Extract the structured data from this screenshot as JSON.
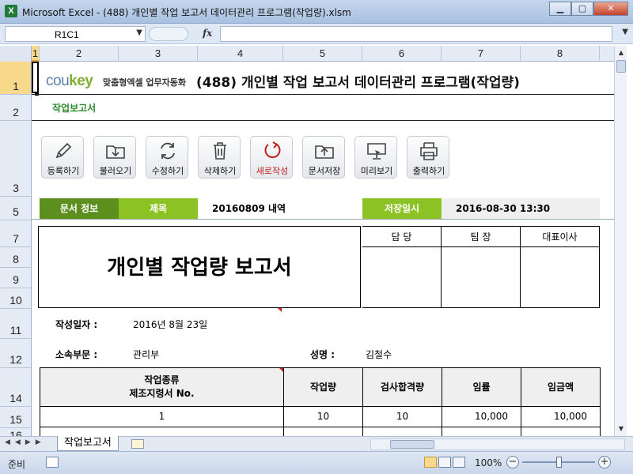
{
  "window": {
    "title": "Microsoft Excel - (488) 개인별 작업 보고서 데이터관리 프로그램(작업량).xlsm",
    "app_icon": "X"
  },
  "formula_bar": {
    "name_box": "R1C1",
    "fx_label": "fx",
    "formula": ""
  },
  "columns": [
    "1",
    "2",
    "3",
    "4",
    "5",
    "6",
    "7",
    "8"
  ],
  "rows": [
    "1",
    "2",
    "3",
    "5",
    "7",
    "8",
    "9",
    "10",
    "11",
    "12",
    "14",
    "15",
    "16"
  ],
  "header": {
    "logo_main": "cou",
    "logo_accent": "key",
    "logo_sub": "맞춤형엑셀 업무자동화",
    "title": "(488) 개인별 작업 보고서 데이터관리 프로그램(작업량)",
    "subtitle": "작업보고서"
  },
  "toolbar": [
    {
      "label": "등록하기",
      "icon": "pencil-icon"
    },
    {
      "label": "불러오기",
      "icon": "download-folder-icon"
    },
    {
      "label": "수정하기",
      "icon": "refresh-icon"
    },
    {
      "label": "삭제하기",
      "icon": "trash-icon"
    },
    {
      "label": "새로작성",
      "icon": "new-document-icon"
    },
    {
      "label": "문서저장",
      "icon": "upload-folder-icon"
    },
    {
      "label": "미리보기",
      "icon": "monitor-icon"
    },
    {
      "label": "출력하기",
      "icon": "printer-icon"
    }
  ],
  "info": {
    "doc_info_label": "문서 정보",
    "title_label": "제목",
    "title_value": "20160809 내역",
    "saved_label": "저장일시",
    "saved_value": "2016-08-30 13:30"
  },
  "report": {
    "big_title": "개인별 작업량 보고서",
    "approvals": [
      "담 당",
      "팀 장",
      "대표이사"
    ],
    "date_label": "작성일자 :",
    "date_value": "2016년 8월 23일",
    "dept_label": "소속부문 :",
    "dept_value": "관리부",
    "name_label": "성명 :",
    "name_value": "김철수"
  },
  "table": {
    "headers": [
      "작업종류",
      "제조지령서 No.",
      "작업량",
      "검사합격량",
      "임률",
      "임금액"
    ],
    "rows": [
      {
        "no": "1",
        "qty": "10",
        "passed": "10",
        "rate": "10,000",
        "amount": "10,000"
      }
    ]
  },
  "sheet_tab": "작업보고서",
  "status": {
    "mode": "준비",
    "zoom": "100%"
  },
  "colors": {
    "accent_green": "#8cc224",
    "dark_green": "#5d8f1f",
    "subtitle_green": "#2c8a2c",
    "new_red": "#c02020"
  }
}
